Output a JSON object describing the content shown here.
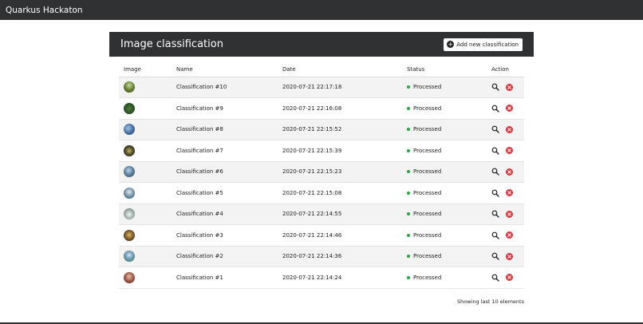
{
  "navbar": {
    "brand": "Quarkus Hackaton"
  },
  "card": {
    "title": "Image classification",
    "add_button_label": "Add new classification"
  },
  "table": {
    "headers": [
      "Image",
      "Name",
      "Date",
      "Status",
      "Action"
    ],
    "rows": [
      {
        "name": "Classification #10",
        "date": "2020-07-21 22:17:18",
        "status": "Processed"
      },
      {
        "name": "Classification #9",
        "date": "2020-07-21 22:16:08",
        "status": "Processed"
      },
      {
        "name": "Classification #8",
        "date": "2020-07-21 22:15:52",
        "status": "Processed"
      },
      {
        "name": "Classification #7",
        "date": "2020-07-21 22:15:39",
        "status": "Processed"
      },
      {
        "name": "Classification #6",
        "date": "2020-07-21 22:15:23",
        "status": "Processed"
      },
      {
        "name": "Classification #5",
        "date": "2020-07-21 22:15:08",
        "status": "Processed"
      },
      {
        "name": "Classification #4",
        "date": "2020-07-21 22:14:55",
        "status": "Processed"
      },
      {
        "name": "Classification #3",
        "date": "2020-07-21 22:14:46",
        "status": "Processed"
      },
      {
        "name": "Classification #2",
        "date": "2020-07-21 22:14:36",
        "status": "Processed"
      },
      {
        "name": "Classification #1",
        "date": "2020-07-21 22:14:24",
        "status": "Processed"
      }
    ]
  },
  "footer": {
    "note": "Showing last 10 elements"
  },
  "colors": {
    "header_bg": "#2f3133",
    "status_ok": "#28a745",
    "delete": "#d9363e"
  }
}
